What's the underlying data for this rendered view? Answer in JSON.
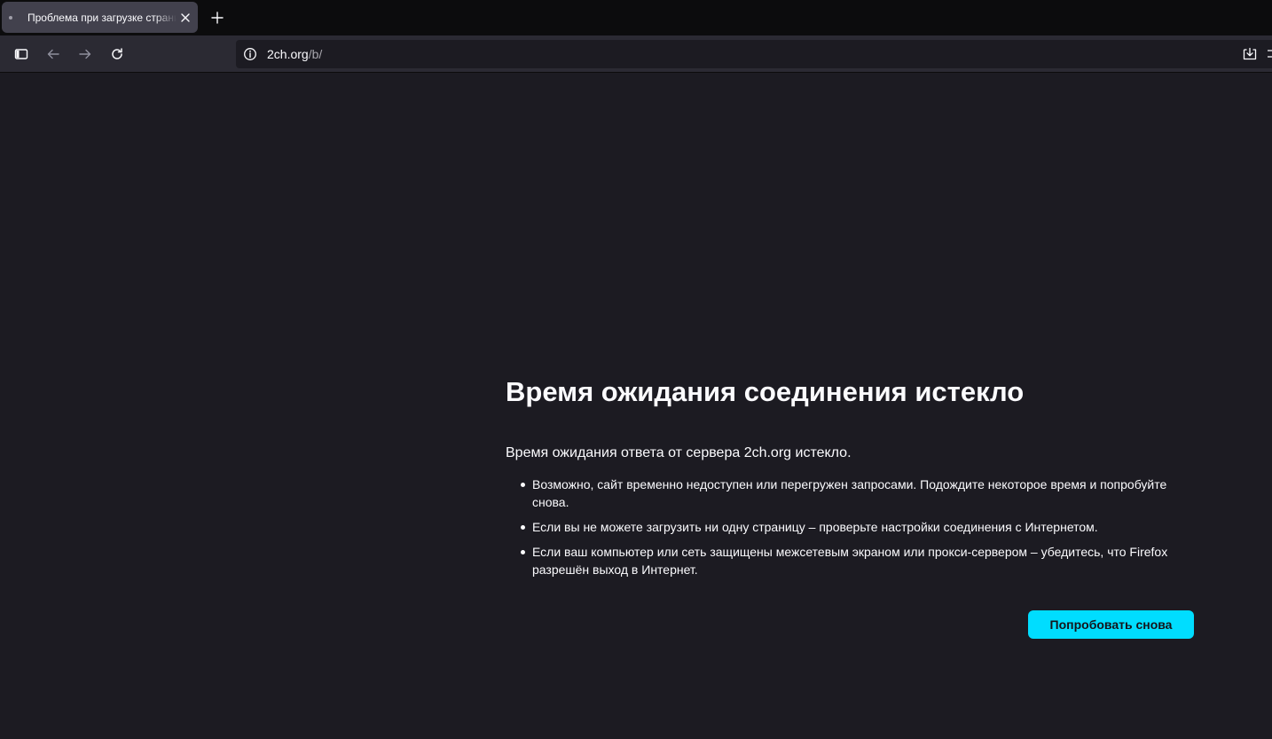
{
  "tabs": [
    {
      "title": "Проблема при загрузке страницы",
      "active": true
    }
  ],
  "toolbar": {
    "icons": {
      "sidebar": "sidebar-icon",
      "back": "back-arrow-icon",
      "forward": "forward-arrow-icon",
      "reload": "reload-icon",
      "site_info": "info-icon",
      "download": "download-icon",
      "new_tab": "plus-icon",
      "tab_close": "close-icon"
    },
    "url": {
      "host": "2ch.org",
      "path": "/b/"
    }
  },
  "error": {
    "title": "Время ожидания соединения истекло",
    "description": "Время ожидания ответа от сервера 2ch.org истекло.",
    "suggestions": [
      "Возможно, сайт временно недоступен или перегружен запросами. Подождите некоторое время и попробуйте снова.",
      "Если вы не можете загрузить ни одну страницу – проверьте настройки соединения с Интернетом.",
      "Если ваш компьютер или сеть защищены межсетевым экраном или прокси-сервером – убедитесь, что Firefox разрешён выход в Интернет."
    ],
    "retry_label": "Попробовать снова"
  },
  "colors": {
    "page_bg": "#1c1b22",
    "toolbar_bg": "#2b2a33",
    "tabstrip_bg": "#0c0c0d",
    "active_tab_bg": "#42414d",
    "accent": "#00ddff",
    "text": "#fbfbfe"
  }
}
